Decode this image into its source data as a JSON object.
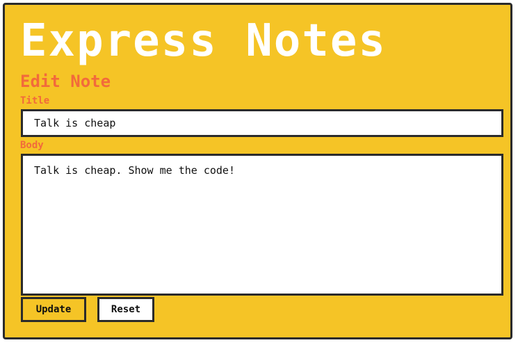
{
  "app": {
    "title": "Express Notes"
  },
  "form": {
    "heading": "Edit Note",
    "title_label": "Title",
    "title_value": "Talk is cheap",
    "body_label": "Body",
    "body_value": "Talk is cheap. Show me the code!"
  },
  "buttons": {
    "update_label": "Update",
    "reset_label": "Reset"
  },
  "colors": {
    "background": "#f5c426",
    "accent": "#f26a3b",
    "border": "#2b2b2b",
    "title_text": "#ffffff"
  }
}
